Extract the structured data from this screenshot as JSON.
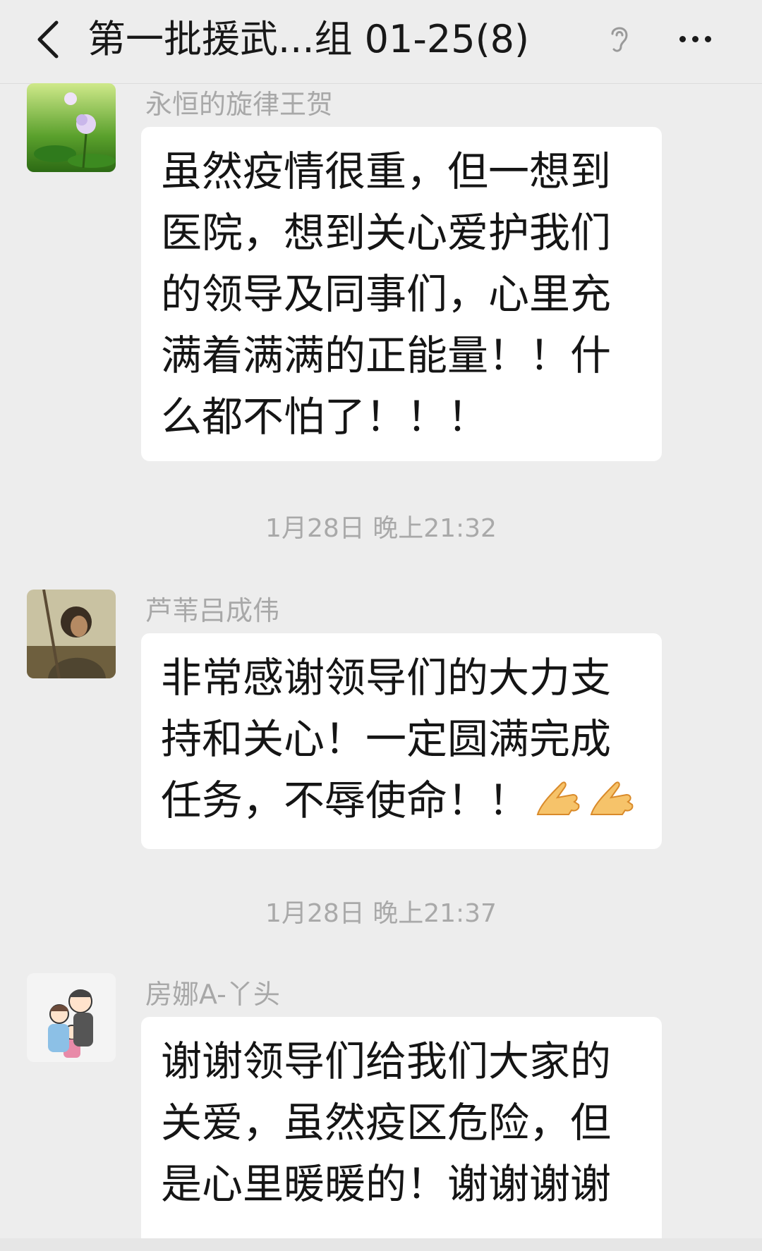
{
  "header": {
    "title": "第一批援武...组 01-25(8)",
    "back_icon": "chevron-left-icon",
    "ear_icon": "ear-icon",
    "more_icon": "more-dots-icon"
  },
  "messages": [
    {
      "sender": "永恒的旋律王贺",
      "text": "虽然疫情很重，但一想到医院，想到关心爱护我们的领导及同事们，心里充满着满满的正能量！！什么都不怕了！！！",
      "avatar": "lotus-avatar"
    },
    {
      "sender": "芦苇吕成伟",
      "text": "非常感谢领导们的大力支持和关心！一定圆满完成任务，不辱使命！！",
      "emojis": [
        "pray-emoji",
        "pray-emoji"
      ],
      "avatar": "swordsman-avatar"
    },
    {
      "sender": "房娜A-丫头",
      "text": "谢谢领导们给我们大家的关爱，虽然疫区危险，但是心里暖暖的！谢谢谢谢",
      "avatar": "cartoon-family-avatar"
    }
  ],
  "timestamps": [
    "1月28日 晚上21:32",
    "1月28日 晚上21:37"
  ],
  "colors": {
    "background": "#ededed",
    "bubble": "#ffffff",
    "sender_name": "#a8a8a8",
    "timestamp": "#a9a9a9",
    "text": "#151515"
  }
}
